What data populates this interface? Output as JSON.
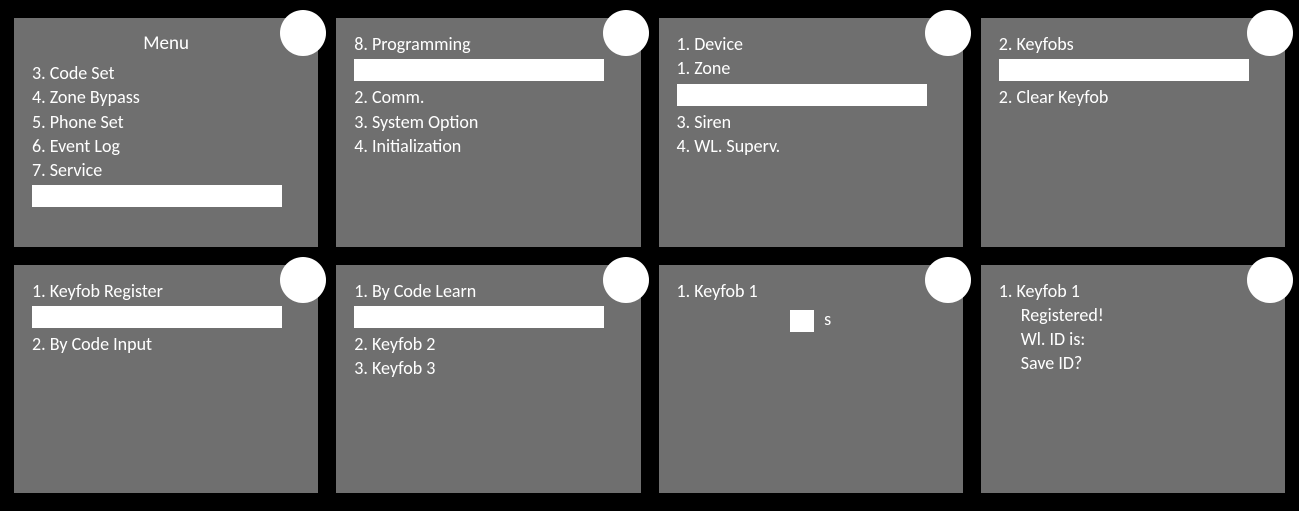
{
  "panels": [
    {
      "title": "Menu",
      "rows": [
        "3. Code Set",
        "4. Zone Bypass",
        "5. Phone Set",
        "6. Event Log",
        "7. Service"
      ],
      "hilite_after": true
    },
    {
      "heading": "8. Programming",
      "hilite_first": true,
      "rows": [
        "2. Comm.",
        "3. System Option",
        "4. Initialization"
      ]
    },
    {
      "rows_before": [
        "1. Device",
        "1. Zone"
      ],
      "hilite_mid": true,
      "rows_after": [
        "3. Siren",
        "4. WL. Superv."
      ]
    },
    {
      "heading": "2. Keyfobs",
      "hilite_first": true,
      "rows": [
        "2. Clear Keyfob"
      ]
    },
    {
      "heading": "1. Keyfob Register",
      "hilite_first": true,
      "rows": [
        "2. By Code Input"
      ]
    },
    {
      "heading": "1. By Code Learn",
      "hilite_first": true,
      "rows": [
        "2. Keyfob 2",
        "",
        "3. Keyfob 3"
      ]
    },
    {
      "heading": "1. Keyfob 1",
      "seconds_suffix": "s"
    },
    {
      "heading": "1. Keyfob 1",
      "status_rows": [
        "Registered!",
        "Wl. ID is:",
        "Save ID?"
      ]
    }
  ]
}
